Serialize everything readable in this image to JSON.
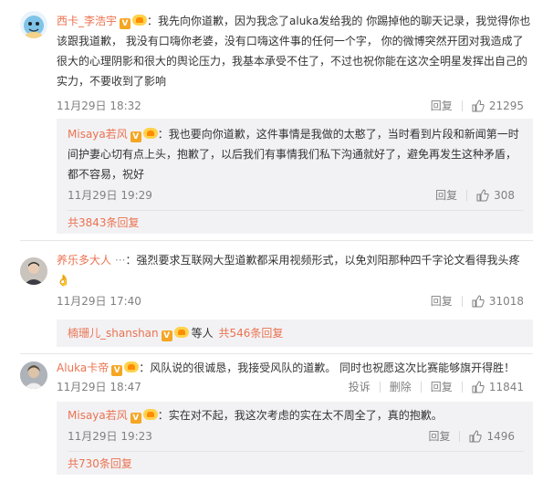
{
  "comments": [
    {
      "user": "西卡_李浩宇",
      "text": "：我先向你道歉，因为我念了aluka发给我的 你踢掉他的聊天记录，我觉得你也该跟我道歉， 我没有口嗨你老婆，没有口嗨这件事的任何一个字， 你的微博突然开团对我造成了很大的心理阴影和很大的舆论压力，我基本承受不住了，不过也祝你能在这次全明星发挥出自己的实力，不要收到了影响",
      "time": "11月29日 18:32",
      "reply_label": "回复",
      "likes": "21295",
      "reply": {
        "user": "Misaya若风",
        "text": "：我也要向你道歉，这件事情是我做的太憨了，当时看到片段和新闻第一时间护妻心切有点上头，抱歉了，以后我们有事情我们私下沟通就好了，避免再发生这种矛盾，都不容易，祝好",
        "time": "11月29日 19:29",
        "reply_label": "回复",
        "likes": "308"
      },
      "more": "共3843条回复"
    },
    {
      "user": "养乐多大人",
      "text": "：强烈要求互联网大型道歉都采用视频形式，以免刘阳那种四千字论文看得我头疼",
      "emoji": "👌",
      "time": "11月29日 17:40",
      "reply_label": "回复",
      "likes": "31018",
      "reply_preview": {
        "user": "楠珊儿_shanshan",
        "suffix": "等人",
        "more": "共546条回复"
      }
    },
    {
      "user": "Aluka卡帝",
      "text": "：风队说的很诚恳，我接受风队的道歉。 同时也祝愿这次比赛能够旗开得胜！",
      "time": "11月29日 18:47",
      "report_label": "投诉",
      "delete_label": "删除",
      "reply_label": "回复",
      "likes": "11841",
      "reply": {
        "user": "Misaya若风",
        "text": "：实在对不起，我这次考虑的实在太不周全了，真的抱歉。",
        "time": "11月29日 19:23",
        "reply_label": "回复",
        "likes": "1496"
      },
      "more": "共730条回复"
    }
  ]
}
